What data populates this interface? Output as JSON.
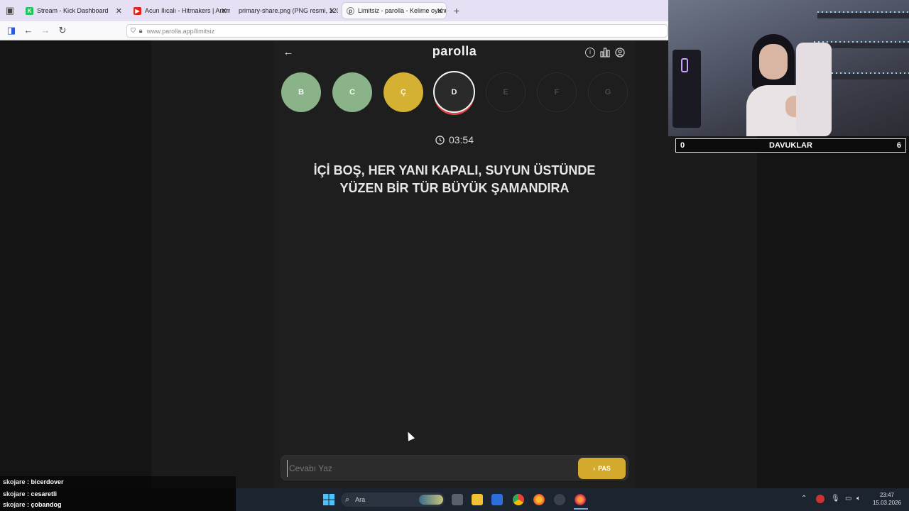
{
  "browser": {
    "tabs": [
      {
        "label": "Stream - Kick Dashboard",
        "active": false
      },
      {
        "label": "Acun Ilıcalı - Hitmakers | Arem",
        "active": false
      },
      {
        "label": "primary-share.png (PNG resmi, 120",
        "active": false
      },
      {
        "label": "Limitsiz - parolla - Kelime oyunu",
        "active": true
      }
    ],
    "new_tab": "+",
    "url": "www.parolla.app/limitsiz"
  },
  "game": {
    "title": "parolla",
    "letters": [
      {
        "letter": "B",
        "state": "done"
      },
      {
        "letter": "C",
        "state": "done"
      },
      {
        "letter": "Ç",
        "state": "pass"
      },
      {
        "letter": "D",
        "state": "current"
      },
      {
        "letter": "E",
        "state": "future"
      },
      {
        "letter": "F",
        "state": "future"
      },
      {
        "letter": "G",
        "state": "future"
      }
    ],
    "timer": "03:54",
    "question": "İÇİ BOŞ, HER YANI KAPALI, SUYUN ÜSTÜNDE YÜZEN BİR TÜR BÜYÜK ŞAMANDIRA",
    "answer_placeholder": "Cevabı Yaz",
    "pass_label": "PAS",
    "colors": {
      "done": "#8ab38a",
      "pass": "#d4b033",
      "current_ring": "#d9474e"
    }
  },
  "scoreboard": {
    "left": "0",
    "name": "DAVUKLAR",
    "right": "6"
  },
  "chat": [
    {
      "user": "skojare",
      "text": "bicerdover"
    },
    {
      "user": "skojare",
      "text": "cesaretli"
    },
    {
      "user": "skojare",
      "text": "çobandog"
    }
  ],
  "taskbar": {
    "search_label": "Ara",
    "time": "23:47",
    "date": "15.03.2026"
  }
}
